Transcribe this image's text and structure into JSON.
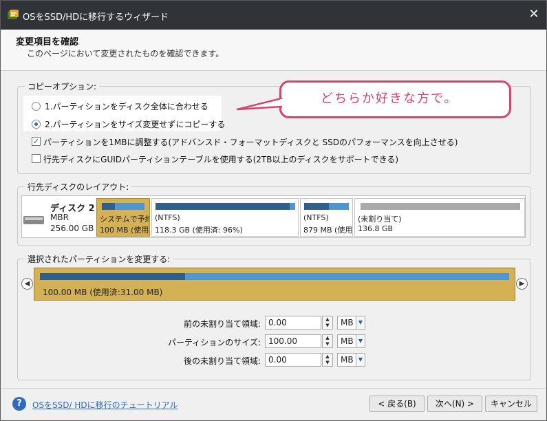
{
  "window": {
    "title": "OSをSSD/HDに移行するウィザード",
    "close_glyph": "✕"
  },
  "header": {
    "title": "変更項目を確認",
    "subtitle": "このページにおいて変更されたものを確認できます。"
  },
  "copy_options": {
    "legend": "コピーオプション:",
    "radio1": "1.パーティションをディスク全体に合わせる",
    "radio2": "2.パーティションをサイズ変更せずにコピーする",
    "check1": "パーティションを1MBに調整する(アドバンスド・フォーマットディスクと SSDのパフォーマンスを向上させる)",
    "check2": "行先ディスクにGUIDパーティションテーブルを使用する(2TB以上のディスクをサポートできる)",
    "check_mark": "✓"
  },
  "callout": {
    "text": "どちらか好きな方で。"
  },
  "layout": {
    "legend": "行先ディスクのレイアウト:",
    "disk_name": "ディスク 2",
    "disk_type": "MBR",
    "disk_size": "256.00 GB",
    "partitions": [
      {
        "line1": "システムで予約",
        "line2": "100 MB (使用",
        "used": 0.31
      },
      {
        "line1": "(NTFS)",
        "line2": "118.3 GB (使用済: 96%)",
        "used": 0.96
      },
      {
        "line1": "(NTFS)",
        "line2": "879 MB (使用",
        "used": 0.55
      },
      {
        "line1": "(未割り当て)",
        "line2": "136.8 GB",
        "used": 1.0
      }
    ]
  },
  "selected": {
    "legend": "選択されたパーティションを変更する:",
    "bar_text": "100.00 MB (使用済:31.00 MB)",
    "used_fraction": 0.31,
    "left_arrow": "◀",
    "right_arrow": "▶"
  },
  "fields": [
    {
      "label": "前の未割り当て領域:",
      "value": "0.00",
      "unit": "MB"
    },
    {
      "label": "パーティションのサイズ:",
      "value": "100.00",
      "unit": "MB"
    },
    {
      "label": "後の未割り当て領域:",
      "value": "0.00",
      "unit": "MB"
    }
  ],
  "footer": {
    "help_glyph": "?",
    "help_link": "OSをSSD/ HDに移行のチュートリアル",
    "back": "< 戻る(B)",
    "next": "次へ(N) >",
    "cancel": "キャンセル"
  },
  "colors": {
    "accent": "#2e6bbf",
    "callout": "#d6436b",
    "selection": "#d4b154",
    "bar_dark": "#2f5f8c",
    "bar_light": "#4f95cf",
    "unallocated": "#a9a9a9"
  }
}
